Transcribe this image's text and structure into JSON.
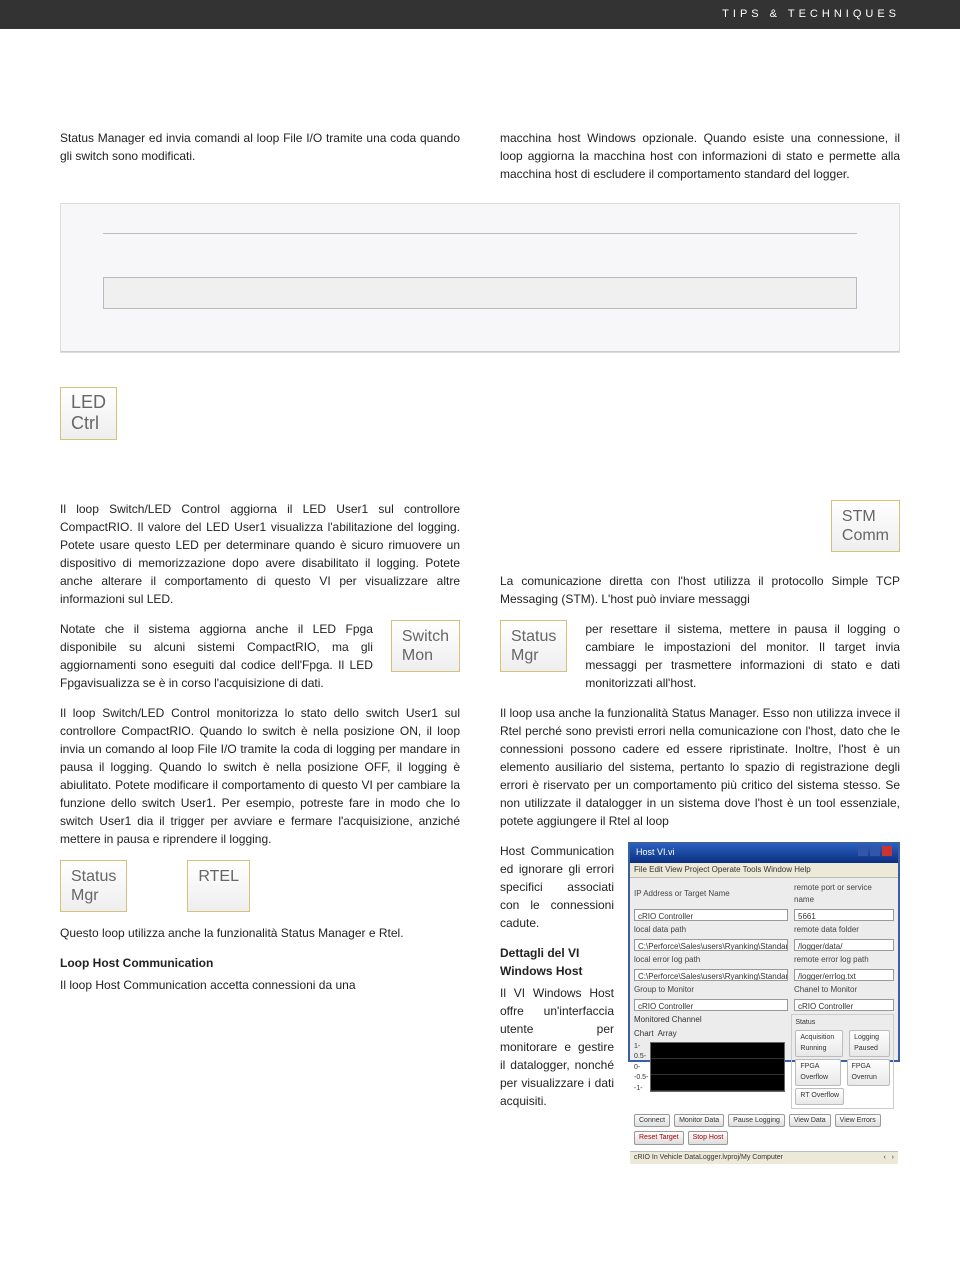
{
  "header": "TIPS & TECHNIQUES",
  "p1": "Status Manager ed invia comandi al loop File I/O tramite una coda quando gli switch sono modificati.",
  "p2": "macchina host Windows opzionale. Quando esiste una connessione, il loop aggiorna la macchina host con informazioni di stato e permette alla macchina host di escludere il comportamento standard del logger.",
  "led_ctrl_tag": "LED\nCtrl",
  "p3": "Il loop Switch/LED Control aggiorna il LED User1 sul controllore CompactRIO. Il valore del LED User1 visualizza l'abilitazione del logging. Potete usare questo LED per determinare quando è sicuro rimuovere un dispositivo di memorizzazione dopo avere disabilitato il logging. Potete anche alterare il comportamento di questo VI per visualizzare altre informazioni sul LED.",
  "p4_left": "Notate che il sistema aggiorna anche il LED Fpga disponibile su alcuni sistemi CompactRIO, ma gli aggiornamenti sono eseguiti dal codice dell'Fpga. Il LED Fpgavisualizza se è in corso l'acquisizione di dati.",
  "switch_mon_tag": "Switch\nMon",
  "status_mgr_tag": "Status\nMgr",
  "p5": "Il loop Switch/LED Control monitorizza lo stato dello switch User1 sul controllore CompactRIO. Quando lo switch è nella posizione ON, il loop invia un comando al loop File I/O tramite la coda di logging per mandare in pausa il logging. Quando lo switch è nella posizione OFF, il logging è abiulitato. Potete modificare il comportamento di questo VI per cambiare la funzione dello switch User1. Per esempio, potreste fare in modo che lo switch User1 dia il trigger per avviare e fermare l'acquisizione, anziché mettere in pausa e riprendere il logging.",
  "rtel_tag": "RTEL",
  "p6": "Questo loop utilizza anche la funzionalità Status Manager e Rtel.",
  "h_loop_host": "Loop Host Communication",
  "p7": "Il loop Host Communication accetta connessioni da una",
  "stm_comm_tag": "STM\nComm",
  "p8": "La comunicazione diretta con l'host utilizza il protocollo Simple TCP Messaging (STM). L'host può inviare messaggi",
  "p8_right": "per resettare il sistema, mettere in pausa il logging o cambiare le impostazioni del monitor. Il target invia messaggi per trasmettere informazioni di stato e dati monitorizzati all'host.",
  "p9": "Il loop usa anche la funzionalità Status Manager. Esso non utilizza invece il Rtel perché sono previsti errori nella comunicazione con l'host, dato che le connessioni possono cadere ed essere ripristinate. Inoltre, l'host è un elemento ausiliario del sistema, pertanto lo spazio di registrazione degli errori è riservato per un comportamento più critico del sistema stesso. Se non utilizzate il datalogger in un sistema dove l'host è un tool essenziale, potete aggiungere il Rtel al loop",
  "p9b": "Host Communication ed ignorare gli errori specifici associati con le connessioni cadute.",
  "h_dettagli": "Dettagli del VI Windows Host",
  "p10": "Il VI Windows Host offre un'interfaccia utente per monitorare e gestire il datalogger, nonché per visualizzare i dati acquisiti.",
  "window": {
    "title": "Host VI.vi",
    "menu": "File  Edit  View  Project  Operate  Tools  Window  Help",
    "ip_label": "IP Address or Target Name",
    "ip_value": "cRIO Controller",
    "port_label": "remote port or service name",
    "port_value": "5661",
    "local_data_label": "local data path",
    "local_data_value": "C:\\Perforce\\Sales\\users\\Ryanking\\Standard cRIO\\Data Files\\data.tdms",
    "remote_data_label": "remote data folder",
    "remote_data_value": "/logger/data/",
    "local_err_label": "local error log path",
    "local_err_value": "C:\\Perforce\\Sales\\users\\Ryanking\\Standard cRIO\\Data Files\\errlog.txt",
    "remote_err_label": "remote error log path",
    "remote_err_value": "/logger/errlog.txt",
    "group_label": "Group to Monitor",
    "group_value": "cRIO Controller",
    "chanel_label": "Chanel to Monitor",
    "chanel_value": "cRIO Controller",
    "monitored": "Monitored Channel",
    "chart_tab1": "Chart",
    "chart_tab2": "Array",
    "chart_y": [
      "1-",
      "0.5-",
      "0-",
      "-0.5-",
      "-1-"
    ],
    "status_label": "Status",
    "status_acq": "Acquisition Running",
    "status_log": "Logging Paused",
    "status_fpga1": "FPGA Overflow",
    "status_fpga2": "FPGA Overrun",
    "status_rt": "RT Overflow",
    "buttons": [
      "Connect",
      "Monitor Data",
      "Pause Logging",
      "View Data",
      "View Errors",
      "Reset Target",
      "Stop Host"
    ],
    "taskbar": "cRIO In Vehicle DataLogger.lvproj/My Computer"
  }
}
